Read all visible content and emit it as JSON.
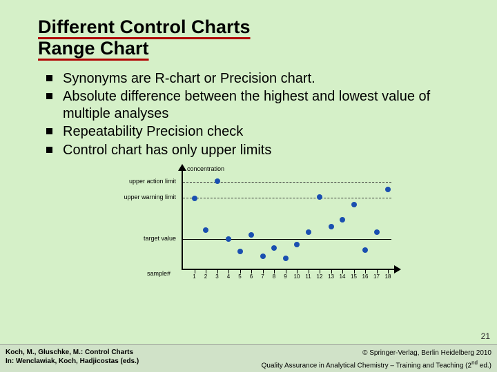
{
  "title_line1": "Different Control Charts",
  "title_line2": "Range Chart",
  "bullets": [
    "Synonyms are R-chart or Precision chart.",
    "Absolute difference between the highest and lowest value of multiple analyses",
    "Repeatability Precision check",
    "Control chart has only upper limits"
  ],
  "chart_data": {
    "type": "scatter",
    "xlabel": "sample#",
    "ylabel": "concentration",
    "x": [
      1,
      2,
      3,
      4,
      5,
      6,
      7,
      8,
      9,
      10,
      11,
      12,
      13,
      14,
      15,
      16,
      17,
      18
    ],
    "ylim": [
      0,
      100
    ],
    "lines": {
      "upper_action_limit": {
        "label": "upper action limit",
        "y": 85
      },
      "upper_warning_limit": {
        "label": "upper warning limit",
        "y": 70
      },
      "target_value": {
        "label": "target value",
        "y": 30
      }
    },
    "points": [
      {
        "x": 1,
        "y": 69
      },
      {
        "x": 2,
        "y": 38
      },
      {
        "x": 3,
        "y": 86
      },
      {
        "x": 4,
        "y": 29
      },
      {
        "x": 5,
        "y": 17
      },
      {
        "x": 6,
        "y": 33
      },
      {
        "x": 7,
        "y": 12
      },
      {
        "x": 8,
        "y": 20
      },
      {
        "x": 9,
        "y": 10
      },
      {
        "x": 10,
        "y": 24
      },
      {
        "x": 11,
        "y": 36
      },
      {
        "x": 12,
        "y": 70
      },
      {
        "x": 13,
        "y": 41
      },
      {
        "x": 14,
        "y": 48
      },
      {
        "x": 15,
        "y": 63
      },
      {
        "x": 16,
        "y": 18
      },
      {
        "x": 17,
        "y": 36
      },
      {
        "x": 18,
        "y": 78
      }
    ]
  },
  "page_number": "21",
  "footer": {
    "left_line1": "Koch, M., Gluschke, M.: Control Charts",
    "left_line2": "In: Wenclawiak, Koch, Hadjicostas (eds.)",
    "right_line1": "© Springer-Verlag, Berlin Heidelberg 2010",
    "right_line2_a": "Quality Assurance in Analytical Chemistry – Training and Teaching (2",
    "right_line2_sup": "nd",
    "right_line2_b": " ed.)"
  }
}
